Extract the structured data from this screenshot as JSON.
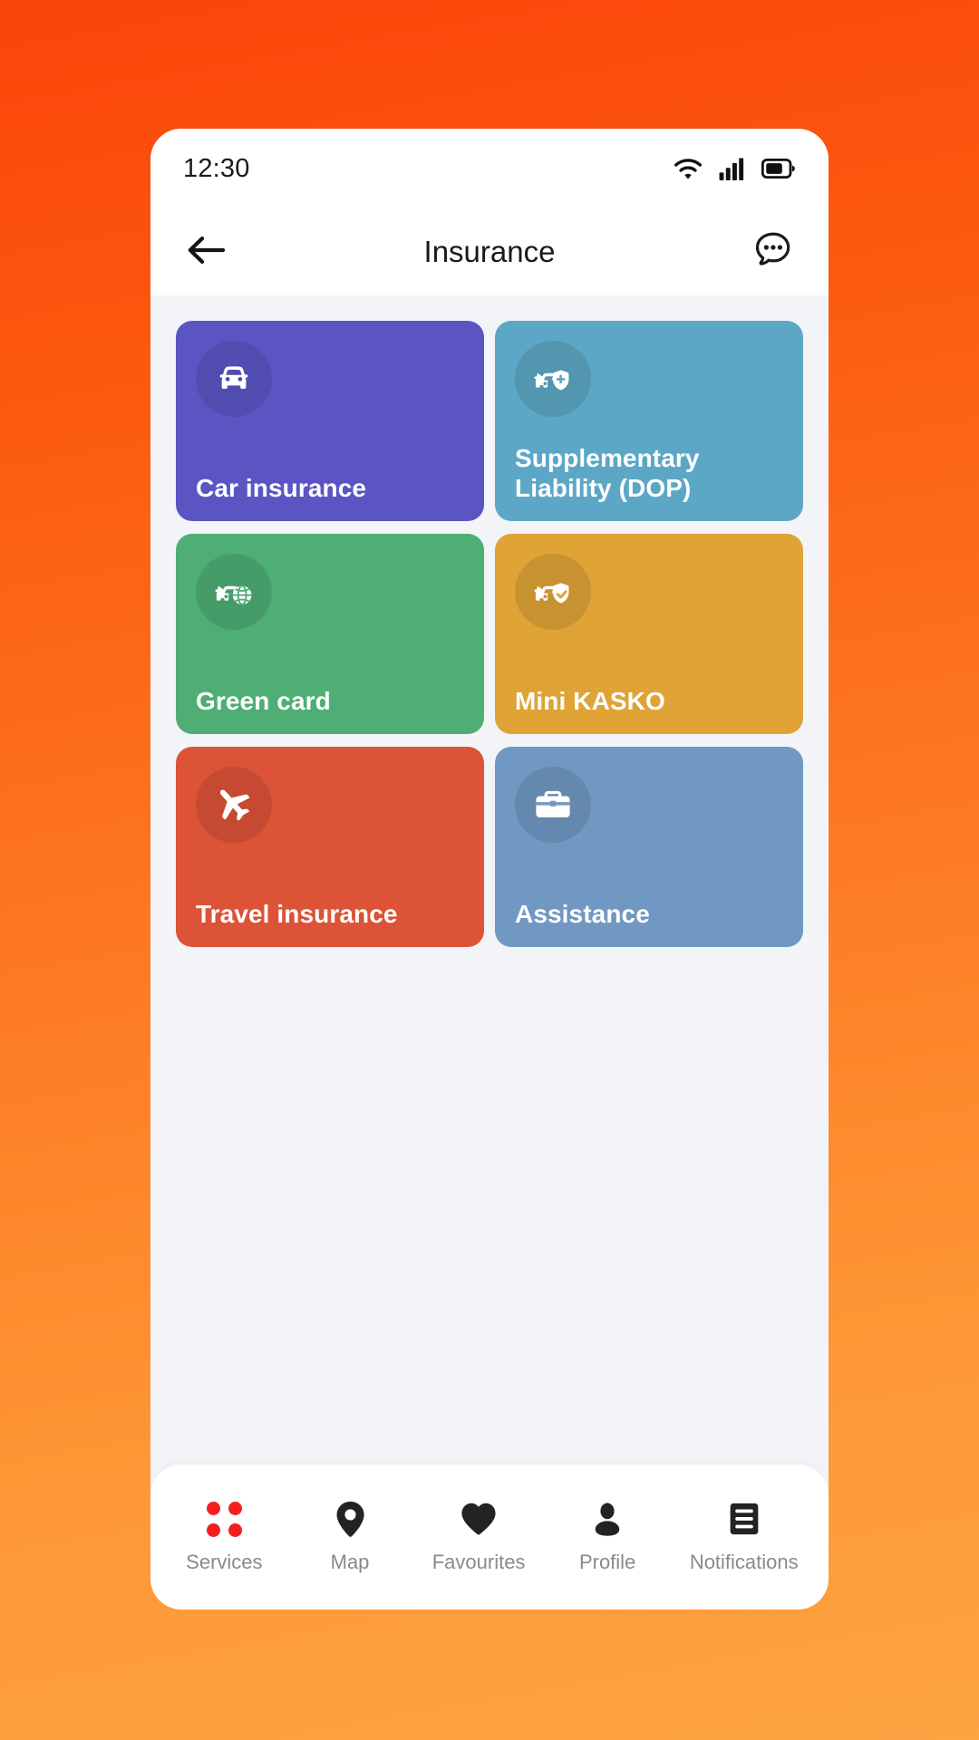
{
  "theme": {
    "bg_gradient_from": "#FB4409",
    "bg_gradient_to": "#FDA342",
    "screen_bg": "#F3F4F7",
    "accent": "#F41E1E",
    "nav_label_color": "#8A8A8E"
  },
  "statusbar": {
    "clock": "12:30",
    "icons": [
      "wifi-icon",
      "cellular-signal-icon",
      "battery-icon"
    ]
  },
  "header": {
    "back_icon": "arrow-left-icon",
    "title": "Insurance",
    "action_icon": "chat-bubble-dots-icon"
  },
  "main": {
    "cards": [
      {
        "label": "Car insurance",
        "icon": "car-front-icon",
        "bg": "#5B55C4"
      },
      {
        "label": "Supplementary Liability (DOP)",
        "icon": "car-shield-plus-icon",
        "bg": "#5CA7C5"
      },
      {
        "label": "Green card",
        "icon": "car-globe-icon",
        "bg": "#4FAE74"
      },
      {
        "label": "Mini KASKO",
        "icon": "car-shield-check-icon",
        "bg": "#DFA336"
      },
      {
        "label": "Travel insurance",
        "icon": "airplane-icon",
        "bg": "#DC5337"
      },
      {
        "label": "Assistance",
        "icon": "briefcase-icon",
        "bg": "#7198C2"
      }
    ]
  },
  "bottom_nav": {
    "items": [
      {
        "label": "Services",
        "icon": "grid-dots-icon",
        "active": true
      },
      {
        "label": "Map",
        "icon": "map-pin-icon",
        "active": false
      },
      {
        "label": "Favourites",
        "icon": "heart-icon",
        "active": false
      },
      {
        "label": "Profile",
        "icon": "person-icon",
        "active": false
      },
      {
        "label": "Notifications",
        "icon": "list-lines-icon",
        "active": false
      }
    ]
  }
}
